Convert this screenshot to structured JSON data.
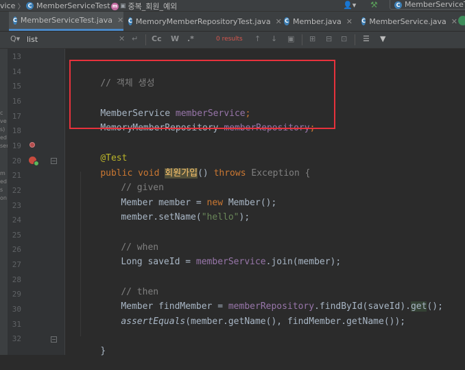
{
  "breadcrumb": {
    "items": [
      "vice",
      "MemberServiceTest",
      "중복_회원_예외"
    ],
    "run_config": "MemberServiceT"
  },
  "tabs": [
    {
      "label": "MemberServiceTest.java",
      "active": true
    },
    {
      "label": "MemoryMemberRepositoryTest.java",
      "active": false
    },
    {
      "label": "Member.java",
      "active": false
    },
    {
      "label": "MemberService.java",
      "active": false
    }
  ],
  "search": {
    "value": "list",
    "results": "0 results",
    "cc": "Cc",
    "w": "W",
    "regex": ".*"
  },
  "line_numbers": [
    "13",
    "14",
    "15",
    "16",
    "17",
    "18",
    "19",
    "20",
    "21",
    "22",
    "23",
    "24",
    "25",
    "26",
    "27",
    "28",
    "29",
    "30",
    "31",
    "32"
  ],
  "left_strip": [
    "c",
    "ve",
    "s)",
    "ed",
    "ser",
    "",
    "m",
    "ed",
    "s",
    "on"
  ],
  "code": {
    "comment_create": "// 객체 생성",
    "l16_type": "MemberService",
    "l16_field": "memberService",
    "l17_type": "MemoryMemberRepository",
    "l17_field": "memberRepository",
    "annotation": "@Test",
    "l20_public": "public",
    "l20_void": "void",
    "l20_method": "회원가입",
    "l20_parens": "()",
    "l20_throws": "throws",
    "l20_exception": "Exception {",
    "comment_given": "// given",
    "l22_decl": "Member member = ",
    "l22_new": "new",
    "l22_ctor": " Member();",
    "l23_call": "member.setName(",
    "l23_str": "\"hello\"",
    "l23_end": ");",
    "comment_when": "// when",
    "l26_decl": "Long saveId = ",
    "l26_field": "memberService",
    "l26_rest": ".join(member);",
    "comment_then": "// then",
    "l29_decl": "Member findMember = ",
    "l29_field": "memberRepository",
    "l29_call": ".findById(saveId).",
    "l29_get": "get",
    "l29_end": "();",
    "l30_assert": "assertEquals",
    "l30_rest": "(member.getName(), findMember.getName());",
    "l32_brace": "}"
  },
  "colors": {
    "keyword": "#cc7832",
    "field": "#9876aa",
    "string": "#6a8759",
    "comment": "#808080",
    "annotation": "#bbb529",
    "highlight_box": "#e8323c"
  }
}
